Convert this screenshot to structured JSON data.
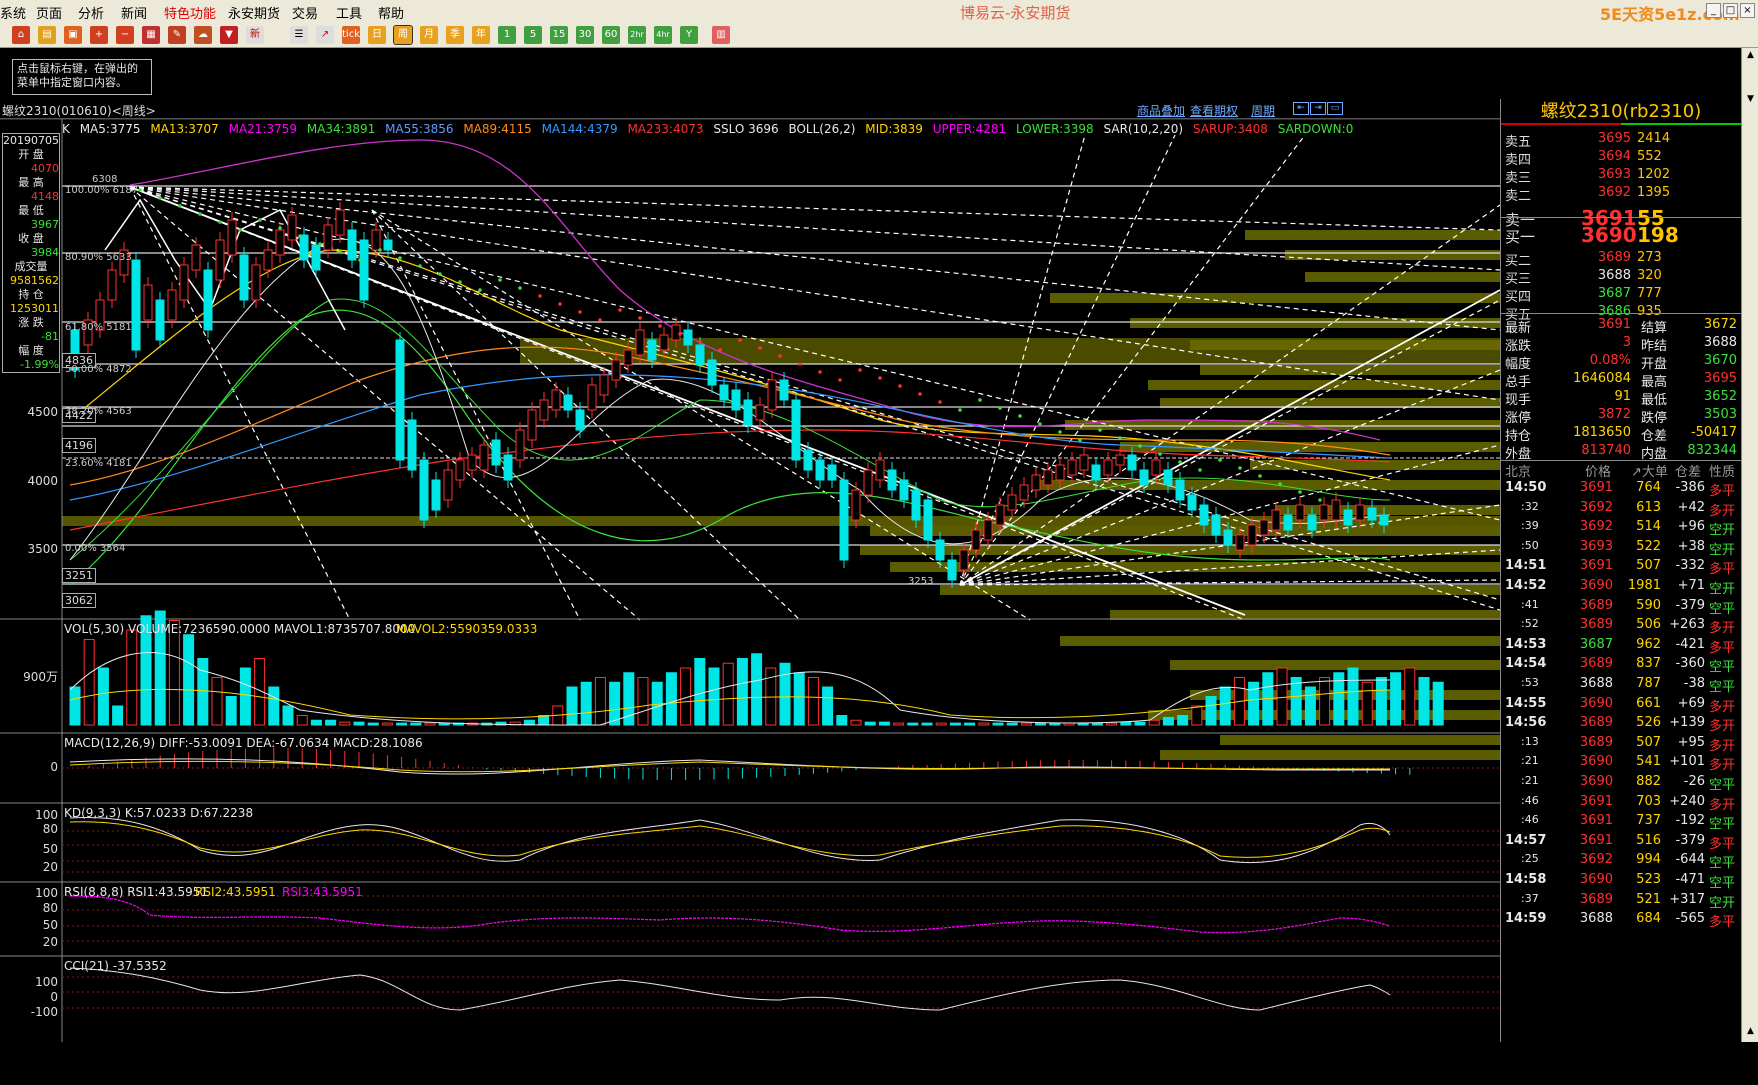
{
  "menu": {
    "items": [
      "系统",
      "页面",
      "分析",
      "新闻",
      "特色功能",
      "永安期货",
      "交易",
      "工具",
      "帮助"
    ],
    "title": "博易云-永安期货",
    "logo": "5E天资5e1z.com"
  },
  "toolbar": {
    "icons": [
      "home-icon",
      "open-icon",
      "open2-icon",
      "zoom-in-icon",
      "zoom-out-icon",
      "layout-icon",
      "draw-icon",
      "cloud-icon",
      "filter-icon",
      "news-icon",
      "list-icon",
      "trend-icon",
      "tick-icon",
      "day-icon",
      "week-icon",
      "month-icon",
      "quarter-icon",
      "year-icon",
      "1min",
      "5min",
      "15min",
      "30min",
      "60min",
      "2hr",
      "4hr",
      "multi",
      "calc-icon"
    ],
    "labels": {
      "tick": "tick",
      "day": "日",
      "week": "周",
      "month": "月",
      "quarter": "季",
      "year": "年",
      "m1": "1",
      "m5": "5",
      "m15": "15",
      "m30": "30",
      "m60": "60",
      "h2": "2hr",
      "h4": "4hr",
      "multi": "Y"
    }
  },
  "hint": "点击鼠标右键，在弹出的菜单中指定窗口内容。",
  "chartbar": {
    "instrument": "螺纹2310(010610)<周线>",
    "links": [
      "商品叠加",
      "查看期权",
      "周期"
    ]
  },
  "legend": {
    "k": "K",
    "ma5": "MA5:3775",
    "ma13": "MA13:3707",
    "ma21": "MA21:3759",
    "ma34": "MA34:3891",
    "ma55": "MA55:3856",
    "ma89": "MA89:4115",
    "ma144": "MA144:4379",
    "ma233": "MA233:4073",
    "sslo": "SSLO  3696",
    "boll": "BOLL(26,2)",
    "mid": "MID:3839",
    "upper": "UPPER:4281",
    "lower": "LOWER:3398",
    "sar": "SAR(10,2,20)",
    "sarup": "SARUP:3408",
    "sardown": "SARDOWN:0"
  },
  "colors": {
    "up": "#ff3030",
    "down": "#00e6e6",
    "ma5": "#e8e8e8",
    "ma13": "#ffd700",
    "ma21": "#ff00ff",
    "ma34": "#3ce03c",
    "ma55": "#6699ff",
    "ma89": "#ff8c1a",
    "ma144": "#3399ff",
    "ma233": "#ff3030",
    "boll": "#cc33cc",
    "fib": "#ffffff",
    "zone": "#6b6b00"
  },
  "datebox": {
    "date": "20190705",
    "open_l": "开  盘",
    "open": "4070",
    "high_l": "最  高",
    "high": "4148",
    "low_l": "最  低",
    "low": "3967",
    "close_l": "收  盘",
    "close": "3984",
    "vol_l": "成交量",
    "vol": "9581562",
    "oi_l": "持  仓",
    "oi": "1253011",
    "chg_l": "涨  跌",
    "chg": "-81",
    "pct_l": "幅  度",
    "pct": "-1.99%"
  },
  "axis": {
    "main": [
      "4500",
      "4000",
      "3500"
    ],
    "boxed": [
      "4836",
      "4422",
      "4196",
      "3251",
      "3062"
    ],
    "fib": [
      "100.00% 6187",
      "80.90% 5633",
      "61.80% 5181",
      "50.00% 4872",
      "38.20% 4563",
      "23.60% 4181",
      "0.00% 3564"
    ],
    "high": "6308",
    "low": "3253",
    "vol": "900万",
    "macd": "0",
    "kd": [
      "100",
      "80",
      "50",
      "20"
    ],
    "rsi": [
      "100",
      "80",
      "50",
      "20"
    ],
    "cci": [
      "100",
      "0",
      "-100"
    ]
  },
  "panels": {
    "vol": "VOL(5,30)  VOLUME:7236590.0000  MAVOL1:8735707.8000",
    "vol2": "MAVOL2:5590359.0333",
    "macd": "MACD(12,26,9)  DIFF:-53.0091  DEA:-67.0634  MACD:28.1086",
    "kd": "KD(9,3,3)  K:57.0233  D:67.2238",
    "rsi": "RSI(8,8,8)  RSI1:43.5951",
    "rsi2": "RSI2:43.5951",
    "rsi3": "RSI3:43.5951",
    "cci": "CCI(21)  -37.5352"
  },
  "quote": {
    "title": "螺纹2310(rb2310)",
    "asks": [
      {
        "n": "卖五",
        "p": "3695",
        "v": "2414"
      },
      {
        "n": "卖四",
        "p": "3694",
        "v": "552"
      },
      {
        "n": "卖三",
        "p": "3693",
        "v": "1202"
      },
      {
        "n": "卖二",
        "p": "3692",
        "v": "1395"
      },
      {
        "n": "卖一",
        "p": "3691",
        "v": "55"
      }
    ],
    "bids": [
      {
        "n": "买一",
        "p": "3690",
        "v": "198"
      },
      {
        "n": "买二",
        "p": "3689",
        "v": "273"
      },
      {
        "n": "买三",
        "p": "3688",
        "v": "320"
      },
      {
        "n": "买四",
        "p": "3687",
        "v": "777"
      },
      {
        "n": "买五",
        "p": "3686",
        "v": "935"
      }
    ],
    "stats": [
      [
        "最新",
        "3691",
        "结算",
        "3672"
      ],
      [
        "涨跌",
        "3",
        "昨结",
        "3688"
      ],
      [
        "幅度",
        "0.08%",
        "开盘",
        "3670"
      ],
      [
        "总手",
        "1646084",
        "最高",
        "3695"
      ],
      [
        "现手",
        "91",
        "最低",
        "3652"
      ],
      [
        "涨停",
        "3872",
        "跌停",
        "3503"
      ],
      [
        "持仓",
        "1813650",
        "仓差",
        "-50417"
      ],
      [
        "外盘",
        "813740",
        "内盘",
        "832344"
      ]
    ],
    "tick_header": [
      "北京",
      "价格",
      "↗大单",
      "仓差",
      "性质"
    ],
    "ticks": [
      [
        "14:50",
        "3691",
        "764",
        "-386",
        "多平"
      ],
      [
        ":32",
        "3692",
        "613",
        "+42",
        "多开"
      ],
      [
        ":39",
        "3692",
        "514",
        "+96",
        "空开"
      ],
      [
        ":50",
        "3693",
        "522",
        "+38",
        "空开"
      ],
      [
        "14:51",
        "3691",
        "507",
        "-332",
        "多平"
      ],
      [
        "14:52",
        "3690",
        "1981",
        "+71",
        "空开"
      ],
      [
        ":41",
        "3689",
        "590",
        "-379",
        "空平"
      ],
      [
        ":52",
        "3689",
        "506",
        "+263",
        "多开"
      ],
      [
        "14:53",
        "3687",
        "962",
        "-421",
        "多平"
      ],
      [
        "14:54",
        "3689",
        "837",
        "-360",
        "空平"
      ],
      [
        ":53",
        "3688",
        "787",
        "-38",
        "空平"
      ],
      [
        "14:55",
        "3690",
        "661",
        "+69",
        "多开"
      ],
      [
        "14:56",
        "3689",
        "526",
        "+139",
        "多开"
      ],
      [
        ":13",
        "3689",
        "507",
        "+95",
        "多开"
      ],
      [
        ":21",
        "3690",
        "541",
        "+101",
        "多开"
      ],
      [
        ":21",
        "3690",
        "882",
        "-26",
        "空平"
      ],
      [
        ":46",
        "3691",
        "703",
        "+240",
        "多开"
      ],
      [
        ":46",
        "3691",
        "737",
        "-192",
        "空平"
      ],
      [
        "14:57",
        "3691",
        "516",
        "-379",
        "多平"
      ],
      [
        ":25",
        "3692",
        "994",
        "-644",
        "空平"
      ],
      [
        "14:58",
        "3690",
        "523",
        "-471",
        "空平"
      ],
      [
        ":37",
        "3689",
        "521",
        "+317",
        "空开"
      ],
      [
        "14:59",
        "3688",
        "684",
        "-565",
        "多平"
      ]
    ]
  }
}
